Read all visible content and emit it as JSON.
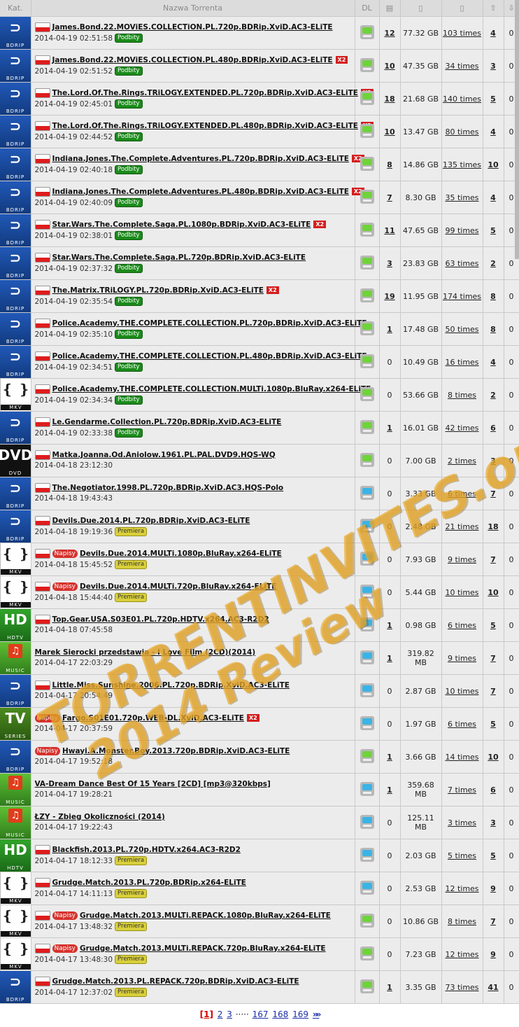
{
  "headers": {
    "kat": "Kat.",
    "name": "Nazwa Torrenta",
    "dl": "DL",
    "files_icon": "files-icon",
    "size_icon": "size-icon",
    "completed_icon": "completed-icon",
    "seeders_icon": "seeders-icon",
    "leechers_icon": "leechers-icon"
  },
  "rows": [
    {
      "cat": "bdrip",
      "cat_label": "BDRIP",
      "napisy": false,
      "title": "James.Bond.22.MOViES.COLLECTiON.PL.720p.BDRip.XviD.AC3-ELiTE",
      "x2": false,
      "date": "2014-04-19 02:51:58",
      "badge": "Podbity",
      "badge_type": "green",
      "dl": "green",
      "files": "12",
      "size": "77.32 GB",
      "times": "103 times",
      "seeders": "4",
      "leechers": "0"
    },
    {
      "cat": "bdrip",
      "cat_label": "BDRIP",
      "napisy": false,
      "title": "James.Bond.22.MOViES.COLLECTiON.PL.480p.BDRip.XviD.AC3-ELiTE",
      "x2": true,
      "date": "2014-04-19 02:51:52",
      "badge": "Podbity",
      "badge_type": "green",
      "dl": "green",
      "files": "10",
      "size": "47.35 GB",
      "times": "34 times",
      "seeders": "3",
      "leechers": "0"
    },
    {
      "cat": "bdrip",
      "cat_label": "BDRIP",
      "napisy": false,
      "title": "The.Lord.Of.The.Rings.TRiLOGY.EXTENDED.PL.720p.BDRip.XviD.AC3-ELiTE",
      "x2": true,
      "date": "2014-04-19 02:45:01",
      "badge": "Podbity",
      "badge_type": "green",
      "dl": "green",
      "files": "18",
      "size": "21.68 GB",
      "times": "140 times",
      "seeders": "5",
      "leechers": "0"
    },
    {
      "cat": "bdrip",
      "cat_label": "BDRIP",
      "napisy": false,
      "title": "The.Lord.Of.The.Rings.TRiLOGY.EXTENDED.PL.480p.BDRip.XviD.AC3-ELiTE",
      "x2": true,
      "date": "2014-04-19 02:44:52",
      "badge": "Podbity",
      "badge_type": "green",
      "dl": "green",
      "files": "10",
      "size": "13.47 GB",
      "times": "80 times",
      "seeders": "4",
      "leechers": "0"
    },
    {
      "cat": "bdrip",
      "cat_label": "BDRIP",
      "napisy": false,
      "title": "Indiana.Jones.The.Complete.Adventures.PL.720p.BDRip.XviD.AC3-ELiTE",
      "x2": true,
      "date": "2014-04-19 02:40:18",
      "badge": "Podbity",
      "badge_type": "green",
      "dl": "green",
      "files": "8",
      "size": "14.86 GB",
      "times": "135 times",
      "seeders": "10",
      "leechers": "0"
    },
    {
      "cat": "bdrip",
      "cat_label": "BDRIP",
      "napisy": false,
      "title": "Indiana.Jones.The.Complete.Adventures.PL.480p.BDRip.XviD.AC3-ELiTE",
      "x2": true,
      "date": "2014-04-19 02:40:09",
      "badge": "Podbity",
      "badge_type": "green",
      "dl": "green",
      "files": "7",
      "size": "8.30 GB",
      "times": "35 times",
      "seeders": "4",
      "leechers": "0"
    },
    {
      "cat": "bdrip",
      "cat_label": "BDRIP",
      "napisy": false,
      "title": "Star.Wars.The.Complete.Saga.PL.1080p.BDRip.XviD.AC3-ELiTE",
      "x2": true,
      "date": "2014-04-19 02:38:01",
      "badge": "Podbity",
      "badge_type": "green",
      "dl": "green",
      "files": "11",
      "size": "47.65 GB",
      "times": "99 times",
      "seeders": "5",
      "leechers": "0"
    },
    {
      "cat": "bdrip",
      "cat_label": "BDRIP",
      "napisy": false,
      "title": "Star.Wars.The.Complete.Saga.PL.720p.BDRip.XviD.AC3-ELiTE",
      "x2": false,
      "date": "2014-04-19 02:37:32",
      "badge": "Podbity",
      "badge_type": "green",
      "dl": "green",
      "files": "3",
      "size": "23.83 GB",
      "times": "63 times",
      "seeders": "2",
      "leechers": "0"
    },
    {
      "cat": "bdrip",
      "cat_label": "BDRIP",
      "napisy": false,
      "title": "The.Matrix.TRiLOGY.PL.720p.BDRip.XviD.AC3-ELiTE",
      "x2": true,
      "date": "2014-04-19 02:35:54",
      "badge": "Podbity",
      "badge_type": "green",
      "dl": "green",
      "files": "19",
      "size": "11.95 GB",
      "times": "174 times",
      "seeders": "8",
      "leechers": "0"
    },
    {
      "cat": "bdrip",
      "cat_label": "BDRIP",
      "napisy": false,
      "title": "Police.Academy.THE.COMPLETE.COLLECTiON.PL.720p.BDRip.XviD.AC3-ELiTE",
      "x2": false,
      "date": "2014-04-19 02:35:10",
      "badge": "Podbity",
      "badge_type": "green",
      "dl": "green",
      "files": "1",
      "size": "17.48 GB",
      "times": "50 times",
      "seeders": "8",
      "leechers": "0"
    },
    {
      "cat": "bdrip",
      "cat_label": "BDRIP",
      "napisy": false,
      "title": "Police.Academy.THE.COMPLETE.COLLECTiON.PL.480p.BDRip.XviD.AC3-ELiTE",
      "x2": false,
      "date": "2014-04-19 02:34:51",
      "badge": "Podbity",
      "badge_type": "green",
      "dl": "green",
      "files": "0",
      "size": "10.49 GB",
      "times": "16 times",
      "seeders": "4",
      "leechers": "0"
    },
    {
      "cat": "mkv",
      "cat_label": "MKV",
      "napisy": false,
      "title": "Police.Academy.THE.COMPLETE.COLLECTiON.MULTi.1080p.BluRay.x264-ELiTE",
      "x2": false,
      "date": "2014-04-19 02:34:34",
      "badge": "Podbity",
      "badge_type": "green",
      "dl": "green",
      "files": "0",
      "size": "53.66 GB",
      "times": "8 times",
      "seeders": "2",
      "leechers": "0"
    },
    {
      "cat": "bdrip",
      "cat_label": "BDRIP",
      "napisy": false,
      "title": "Le.Gendarme.Collection.PL.720p.BDRip.XviD.AC3-ELiTE",
      "x2": false,
      "date": "2014-04-19 02:33:38",
      "badge": "Podbity",
      "badge_type": "green",
      "dl": "green",
      "files": "1",
      "size": "16.01 GB",
      "times": "42 times",
      "seeders": "6",
      "leechers": "0"
    },
    {
      "cat": "dvd",
      "cat_label": "DVD",
      "napisy": false,
      "title": "Matka.Joanna.Od.Aniolow.1961.PL.PAL.DVD9.HQS-WQ",
      "x2": false,
      "date": "2014-04-18 23:12:30",
      "badge": "",
      "badge_type": "",
      "dl": "green",
      "files": "0",
      "size": "7.00 GB",
      "times": "2 times",
      "seeders": "3",
      "leechers": "0"
    },
    {
      "cat": "bdrip",
      "cat_label": "BDRIP",
      "napisy": false,
      "title": "The.Negotiator.1998.PL.720p.BDRip.XviD.AC3.HQS-Polo",
      "x2": false,
      "date": "2014-04-18 19:43:43",
      "badge": "",
      "badge_type": "",
      "dl": "blue",
      "files": "0",
      "size": "3.33 GB",
      "times": "6 times",
      "seeders": "7",
      "leechers": "0"
    },
    {
      "cat": "bdrip",
      "cat_label": "BDRIP",
      "napisy": false,
      "title": "Devils.Due.2014.PL.720p.BDRip.XviD.AC3-ELiTE",
      "x2": false,
      "date": "2014-04-18 19:19:36",
      "badge": "Premiera",
      "badge_type": "yellow",
      "dl": "blue",
      "files": "0",
      "size": "2.48 GB",
      "times": "21 times",
      "seeders": "18",
      "leechers": "0"
    },
    {
      "cat": "mkv",
      "cat_label": "MKV",
      "napisy": true,
      "title": "Devils.Due.2014.MULTi.1080p.BluRay.x264-ELiTE",
      "x2": false,
      "date": "2014-04-18 15:45:52",
      "badge": "Premiera",
      "badge_type": "yellow",
      "dl": "blue",
      "files": "0",
      "size": "7.93 GB",
      "times": "9 times",
      "seeders": "7",
      "leechers": "0"
    },
    {
      "cat": "mkv",
      "cat_label": "MKV",
      "napisy": true,
      "title": "Devils.Due.2014.MULTi.720p.BluRay.x264-ELiTE",
      "x2": false,
      "date": "2014-04-18 15:44:40",
      "badge": "Premiera",
      "badge_type": "yellow",
      "dl": "blue",
      "files": "0",
      "size": "5.44 GB",
      "times": "10 times",
      "seeders": "10",
      "leechers": "0"
    },
    {
      "cat": "hdtv",
      "cat_label": "HDTV",
      "napisy": false,
      "title": "Top.Gear.USA.S03E01.PL.720p.HDTV.x264.AC3-R2D2",
      "x2": false,
      "date": "2014-04-18 07:45:58",
      "badge": "",
      "badge_type": "",
      "dl": "blue",
      "files": "1",
      "size": "0.98 GB",
      "times": "6 times",
      "seeders": "5",
      "leechers": "0"
    },
    {
      "cat": "music",
      "cat_label": "MUSIC",
      "napisy": false,
      "flag": false,
      "title": "Marek Sierocki przedstawia - I Love Film (2CD)(2014)",
      "x2": false,
      "date": "2014-04-17 22:03:29",
      "badge": "",
      "badge_type": "",
      "dl": "blue",
      "files": "1",
      "size": "319.82 MB",
      "times": "9 times",
      "seeders": "7",
      "leechers": "0"
    },
    {
      "cat": "bdrip",
      "cat_label": "BDRIP",
      "napisy": false,
      "title": "Little.Miss.Sunshine.2006.PL.720p.BDRip.XviD.AC3-ELiTE",
      "x2": false,
      "date": "2014-04-17 20:54:49",
      "badge": "",
      "badge_type": "",
      "dl": "blue",
      "files": "0",
      "size": "2.87 GB",
      "times": "10 times",
      "seeders": "7",
      "leechers": "0"
    },
    {
      "cat": "tv",
      "cat_label": "SERIES",
      "napisy": true,
      "flag": false,
      "title": "Fargo.S01E01.720p.WEB-DL.XviD.AC3-ELiTE",
      "x2": true,
      "date": "2014-04-17 20:37:59",
      "badge": "",
      "badge_type": "",
      "dl": "blue",
      "files": "0",
      "size": "1.97 GB",
      "times": "6 times",
      "seeders": "5",
      "leechers": "0"
    },
    {
      "cat": "bdrip",
      "cat_label": "BDRIP",
      "napisy": true,
      "flag": false,
      "title": "Hwayi.A.Monster.Boy.2013.720p.BDRip.XviD.AC3-ELiTE",
      "x2": false,
      "date": "2014-04-17 19:52:18",
      "badge": "",
      "badge_type": "",
      "dl": "green",
      "files": "1",
      "size": "3.66 GB",
      "times": "14 times",
      "seeders": "10",
      "leechers": "0"
    },
    {
      "cat": "music",
      "cat_label": "MUSIC",
      "napisy": false,
      "flag": false,
      "title": "VA-Dream Dance Best Of 15 Years [2CD] [mp3@320kbps]",
      "x2": false,
      "date": "2014-04-17 19:28:21",
      "badge": "",
      "badge_type": "",
      "dl": "blue",
      "files": "1",
      "size": "359.68 MB",
      "times": "7 times",
      "seeders": "6",
      "leechers": "0"
    },
    {
      "cat": "music",
      "cat_label": "MUSIC",
      "napisy": false,
      "flag": false,
      "title": "ŁZY - Zbieg Okoliczności (2014)",
      "x2": false,
      "date": "2014-04-17 19:22:43",
      "badge": "",
      "badge_type": "",
      "dl": "blue",
      "files": "0",
      "size": "125.11 MB",
      "times": "3 times",
      "seeders": "3",
      "leechers": "0"
    },
    {
      "cat": "hdtv",
      "cat_label": "HDTV",
      "napisy": false,
      "title": "Blackfish.2013.PL.720p.HDTV.x264.AC3-R2D2",
      "x2": false,
      "date": "2014-04-17 18:12:33",
      "badge": "Premiera",
      "badge_type": "yellow",
      "dl": "blue",
      "files": "0",
      "size": "2.03 GB",
      "times": "5 times",
      "seeders": "5",
      "leechers": "0"
    },
    {
      "cat": "mkv",
      "cat_label": "MKV",
      "napisy": false,
      "title": "Grudge.Match.2013.PL.720p.BDRip.x264-ELiTE",
      "x2": false,
      "date": "2014-04-17 14:11:13",
      "badge": "Premiera",
      "badge_type": "yellow",
      "dl": "blue",
      "files": "0",
      "size": "2.53 GB",
      "times": "12 times",
      "seeders": "9",
      "leechers": "0"
    },
    {
      "cat": "mkv",
      "cat_label": "MKV",
      "napisy": true,
      "title": "Grudge.Match.2013.MULTi.REPACK.1080p.BluRay.x264-ELiTE",
      "x2": false,
      "date": "2014-04-17 13:48:32",
      "badge": "Premiera",
      "badge_type": "yellow",
      "dl": "green",
      "files": "0",
      "size": "10.86 GB",
      "times": "8 times",
      "seeders": "7",
      "leechers": "0"
    },
    {
      "cat": "mkv",
      "cat_label": "MKV",
      "napisy": true,
      "title": "Grudge.Match.2013.MULTi.REPACK.720p.BluRay.x264-ELiTE",
      "x2": false,
      "date": "2014-04-17 13:48:30",
      "badge": "Premiera",
      "badge_type": "yellow",
      "dl": "green",
      "files": "0",
      "size": "7.23 GB",
      "times": "12 times",
      "seeders": "9",
      "leechers": "0"
    },
    {
      "cat": "bdrip",
      "cat_label": "BDRIP",
      "napisy": false,
      "title": "Grudge.Match.2013.PL.REPACK.720p.BDRip.XviD.AC3-ELiTE",
      "x2": false,
      "date": "2014-04-17 12:37:02",
      "badge": "Premiera",
      "badge_type": "yellow",
      "dl": "green",
      "files": "1",
      "size": "3.35 GB",
      "times": "73 times",
      "seeders": "41",
      "leechers": "0"
    }
  ],
  "labels": {
    "napisy": "Napisy",
    "x2": "X2"
  },
  "pagination": {
    "current": "[1]",
    "pages": [
      "2",
      "3"
    ],
    "dots": "·····",
    "tail_pages": [
      "167",
      "168",
      "169"
    ],
    "next": "»»"
  },
  "watermark": {
    "line1": "TORRENTINVITES.org",
    "line2": "2014 Review"
  },
  "colors": {
    "header_bg": "#dcdcdc",
    "row_bg": "#ececec",
    "badge_green": "#1b8a1b",
    "badge_yellow": "#d9cf3c",
    "flag_red": "#dd1d1d",
    "link_blue": "#1c2fa8",
    "current_page": "#d20000"
  }
}
